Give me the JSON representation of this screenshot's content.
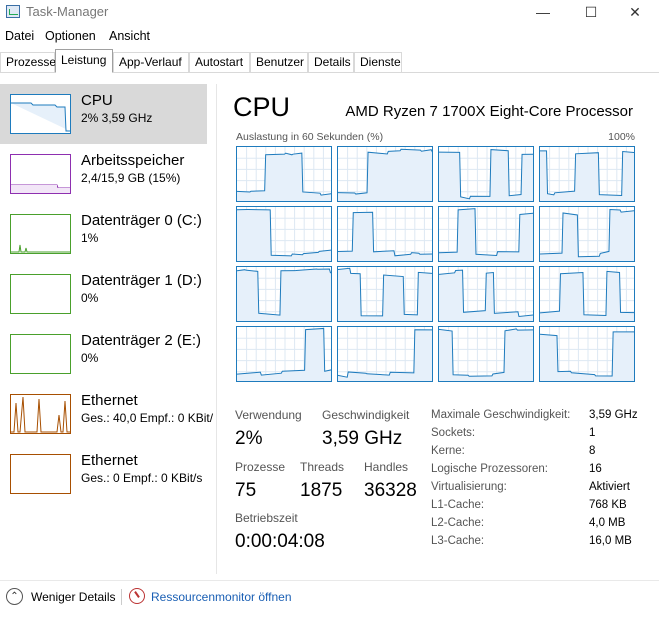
{
  "window": {
    "title": "Task-Manager",
    "min_glyph": "—",
    "max_glyph": "☐",
    "close_glyph": "✕",
    "icon": "task-manager-icon"
  },
  "menu": [
    "Datei",
    "Optionen",
    "Ansicht"
  ],
  "tabs": [
    {
      "label": "Prozesse"
    },
    {
      "label": "Leistung"
    },
    {
      "label": "App-Verlauf"
    },
    {
      "label": "Autostart"
    },
    {
      "label": "Benutzer"
    },
    {
      "label": "Details"
    },
    {
      "label": "Dienste"
    }
  ],
  "active_tab": "Leistung",
  "sidebar": [
    {
      "name": "CPU",
      "sub": "2% 3,59 GHz",
      "color": "#1e7bbd"
    },
    {
      "name": "Arbeitsspeicher",
      "sub": "2,4/15,9 GB (15%)",
      "color": "#8e2fb0"
    },
    {
      "name": "Datenträger 0 (C:)",
      "sub": "1%",
      "color": "#4aa02c"
    },
    {
      "name": "Datenträger 1 (D:)",
      "sub": "0%",
      "color": "#4aa02c"
    },
    {
      "name": "Datenträger 2 (E:)",
      "sub": "0%",
      "color": "#4aa02c"
    },
    {
      "name": "Ethernet",
      "sub": "Ges.: 40,0 Empf.: 0 KBit/",
      "color": "#a74f01"
    },
    {
      "name": "Ethernet",
      "sub": "Ges.: 0 Empf.: 0 KBit/s",
      "color": "#a74f01"
    }
  ],
  "main": {
    "title": "CPU",
    "processor": "AMD Ryzen 7 1700X Eight-Core Processor",
    "util_label": "Auslastung in 60 Sekunden (%)",
    "util_max": "100%",
    "core_count": 16
  },
  "stats": {
    "usage_label": "Verwendung",
    "usage_value": "2%",
    "speed_label": "Geschwindigkeit",
    "speed_value": "3,59 GHz",
    "processes_label": "Prozesse",
    "processes_value": "75",
    "threads_label": "Threads",
    "threads_value": "1875",
    "handles_label": "Handles",
    "handles_value": "36328",
    "uptime_label": "Betriebszeit",
    "uptime_value": "0:00:04:08"
  },
  "details": [
    {
      "label": "Maximale Geschwindigkeit:",
      "value": "3,59 GHz"
    },
    {
      "label": "Sockets:",
      "value": "1"
    },
    {
      "label": "Kerne:",
      "value": "8"
    },
    {
      "label": "Logische Prozessoren:",
      "value": "16"
    },
    {
      "label": "Virtualisierung:",
      "value": "Aktiviert"
    },
    {
      "label": "L1-Cache:",
      "value": "768 KB"
    },
    {
      "label": "L2-Cache:",
      "value": "4,0 MB"
    },
    {
      "label": "L3-Cache:",
      "value": "16,0 MB"
    }
  ],
  "footer": {
    "less_details": "Weniger Details",
    "less_details_glyph": "⌃",
    "resource_monitor": "Ressourcenmonitor öffnen"
  }
}
